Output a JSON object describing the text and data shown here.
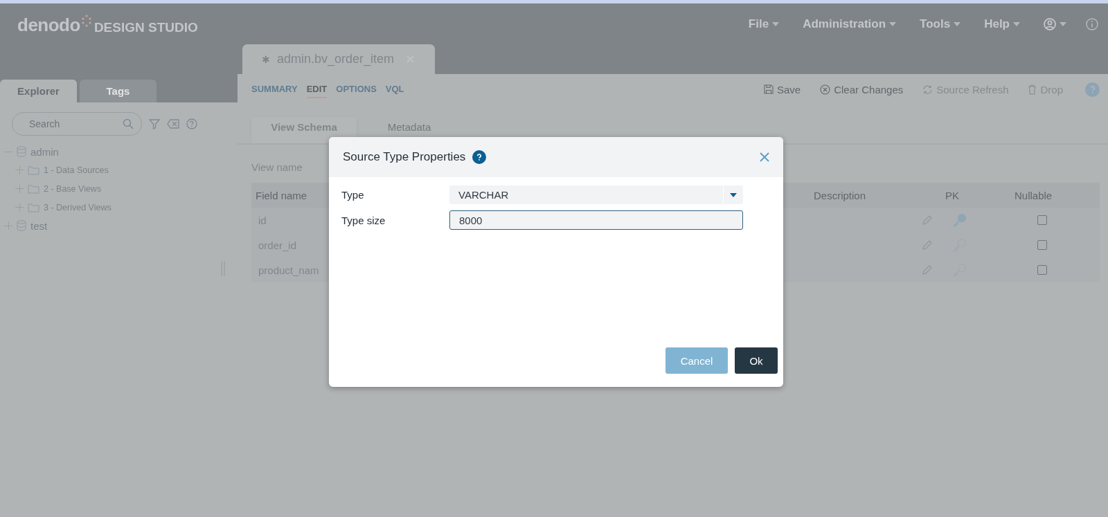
{
  "app": {
    "logo": "denodo",
    "product": "DESIGN STUDIO"
  },
  "menu": [
    {
      "label": "File"
    },
    {
      "label": "Administration"
    },
    {
      "label": "Tools"
    },
    {
      "label": "Help"
    }
  ],
  "sidebar": {
    "tabs": [
      {
        "label": "Explorer",
        "selected": true
      },
      {
        "label": "Tags",
        "selected": false
      }
    ],
    "search": {
      "placeholder": "Search"
    },
    "tree": [
      {
        "label": "admin",
        "kind": "database",
        "expanded": true,
        "children": [
          {
            "label": "1 - Data Sources",
            "kind": "folder",
            "expanded": false
          },
          {
            "label": "2 - Base Views",
            "kind": "folder",
            "expanded": false
          },
          {
            "label": "3 - Derived Views",
            "kind": "folder",
            "expanded": false
          }
        ]
      },
      {
        "label": "test",
        "kind": "database",
        "expanded": false
      }
    ]
  },
  "editor": {
    "tab": {
      "title": "admin.bv_order_item",
      "modified_mark": "✱"
    },
    "subtabs": [
      {
        "label": "SUMMARY",
        "selected": false
      },
      {
        "label": "EDIT",
        "selected": true
      },
      {
        "label": "OPTIONS",
        "selected": false
      },
      {
        "label": "VQL",
        "selected": false
      }
    ],
    "actions": [
      {
        "label": "Save",
        "kind": "save",
        "disabled": false
      },
      {
        "label": "Clear Changes",
        "kind": "clear",
        "disabled": false
      },
      {
        "label": "Source Refresh",
        "kind": "refresh",
        "disabled": true
      },
      {
        "label": "Drop",
        "kind": "drop",
        "disabled": true
      }
    ],
    "view_tabs": [
      {
        "label": "View Schema",
        "selected": true
      },
      {
        "label": "Metadata",
        "selected": false
      }
    ],
    "view_name_label": "View name",
    "table": {
      "columns": [
        "Field name",
        "Description",
        "PK",
        "Nullable"
      ],
      "rows": [
        {
          "field": "id",
          "pk": true,
          "nullable": false
        },
        {
          "field": "order_id",
          "pk": false,
          "nullable": false
        },
        {
          "field": "product_nam",
          "pk": false,
          "nullable": false
        }
      ]
    }
  },
  "dialog": {
    "title": "Source Type Properties",
    "fields": [
      {
        "label": "Type",
        "kind": "select",
        "value": "VARCHAR"
      },
      {
        "label": "Type size",
        "kind": "input",
        "value": "8000"
      }
    ],
    "buttons": [
      {
        "label": "Cancel",
        "kind": "secondary"
      },
      {
        "label": "Ok",
        "kind": "primary"
      }
    ]
  }
}
